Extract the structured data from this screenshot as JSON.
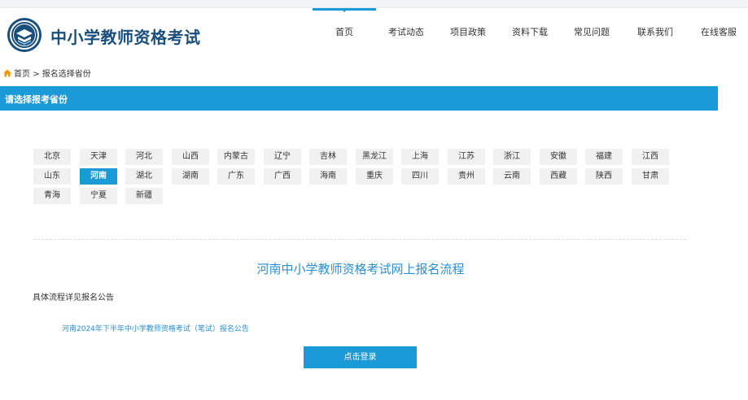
{
  "header": {
    "site_title": "中小学教师资格考试"
  },
  "nav": {
    "items": [
      {
        "label": "首页",
        "active": true
      },
      {
        "label": "考试动态"
      },
      {
        "label": "项目政策"
      },
      {
        "label": "资料下载"
      },
      {
        "label": "常见问题"
      },
      {
        "label": "联系我们"
      },
      {
        "label": "在线客服"
      }
    ]
  },
  "breadcrumb": {
    "home": "首页",
    "separator": ">",
    "current": "报名选择省份"
  },
  "section": {
    "title": "请选择报考省份"
  },
  "provinces": [
    "北京",
    "天津",
    "河北",
    "山西",
    "内蒙古",
    "辽宁",
    "吉林",
    "黑龙江",
    "上海",
    "江苏",
    "浙江",
    "安徽",
    "福建",
    "江西",
    "山东",
    "河南",
    "湖北",
    "湖南",
    "广东",
    "广西",
    "海南",
    "重庆",
    "四川",
    "贵州",
    "云南",
    "西藏",
    "陕西",
    "甘肃",
    "青海",
    "宁夏",
    "新疆"
  ],
  "selected_province": "河南",
  "flow": {
    "title": "河南中小学教师资格考试网上报名流程",
    "detail_label": "具体流程详见报名公告",
    "notice_link": "河南2024年下半年中小学教师资格考试（笔试）报名公告",
    "login_button": "点击登录"
  },
  "colors": {
    "accent": "#1a9ad6",
    "brand": "#1a4e7c",
    "link": "#2a8ed4"
  }
}
